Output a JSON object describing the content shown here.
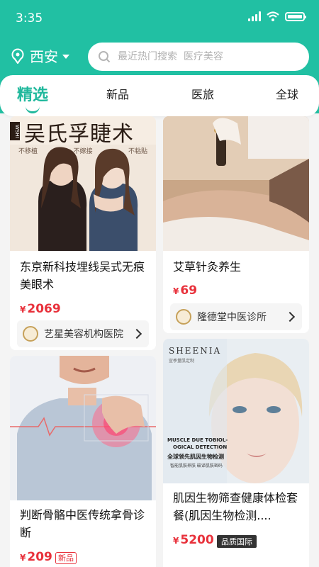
{
  "status": {
    "time": "3:35"
  },
  "location": {
    "city": "西安"
  },
  "search": {
    "placeholder": "最近热门搜索  医疗美容"
  },
  "tabs": [
    {
      "label": "精选",
      "active": true
    },
    {
      "label": "新品"
    },
    {
      "label": "医旅"
    },
    {
      "label": "全球"
    }
  ],
  "cards": [
    {
      "banner_title": "吴氏孚睫术",
      "banner_brand": "WSHI",
      "banner_sub": [
        "不移植",
        "不嫁接",
        "不粘贴"
      ],
      "title": "东京新科技埋线吴式无痕美眼术",
      "price": "2069",
      "currency": "¥",
      "shop": "艺星美容机构医院"
    },
    {
      "title": "艾草针灸养生",
      "price": "69",
      "currency": "¥",
      "shop": "隆德堂中医诊所"
    },
    {
      "title": "判断骨骼中医传统拿骨诊断",
      "price": "209",
      "currency": "¥",
      "tag": "新品"
    },
    {
      "brand": "SHEENIA",
      "brand_sub": "宣季量肌定制",
      "overlay_line1": "MUSCLE DUE TOBIOL-",
      "overlay_line2": "OGICAL DETECTION",
      "overlay_cn": "全球领先肌因生物检测",
      "overlay_cn_sub": "智能肌肤养肤 破译肌肤密码",
      "title": "肌因生物筛查健康体检套餐(肌因生物检测....",
      "price": "5200",
      "currency": "¥",
      "tag": "品质国际"
    }
  ],
  "colors": {
    "primary": "#21c0a3",
    "price": "#e8313b"
  }
}
